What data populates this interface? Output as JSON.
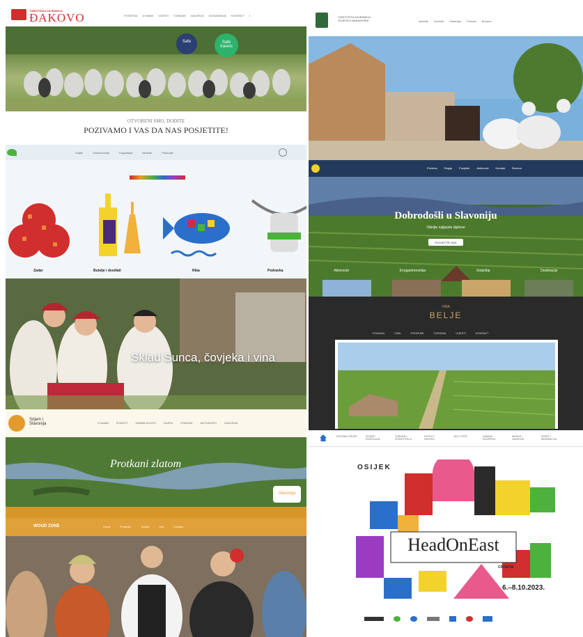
{
  "djakovo": {
    "logo_top": "TURISTIČKA ZAJEDNICA",
    "logo_main": "ĐAKOVO",
    "nav": [
      "POČETNA",
      "O NAMA",
      "VIJESTI",
      "TURIZAM",
      "GALERIJA",
      "DOGAĐANJA",
      "KONTAKT"
    ],
    "badge_safe": "Safe",
    "badge_safe_travels": "Safe travels",
    "subtitle": "OTVORENI SMO, DOĐITE",
    "headline": "POZIVAMO I VAS DA NAS POSJETITE!"
  },
  "lipizzaner": {
    "logo_text": "TURISTIČKA ZAJEDNICA OSJEČKO-BARANJSKE",
    "nav": [
      "Istražite",
      "Doživite",
      "Planirajte",
      "Ponude",
      "Brošure"
    ]
  },
  "gastro": {
    "nav": [
      "Osijek",
      "Gastronomija",
      "Događanja",
      "Istražite",
      "Planirajte"
    ],
    "items": [
      {
        "label": "Zadar"
      },
      {
        "label": "Butelje i destilati"
      },
      {
        "label": "Riba"
      },
      {
        "label": "Podravka"
      }
    ]
  },
  "slavonija_welcome": {
    "nav": [
      "Početna",
      "Regija",
      "Posjetite",
      "Aktivnosti",
      "Kontakt",
      "Brošure"
    ],
    "headline": "Dobrodošli u Slavoniju",
    "sub": "Otkrijte najljepše dijelove",
    "button": "POSJETITE NAS",
    "categories": [
      "Aktivnosti",
      "Enogastronomija",
      "Smještaj",
      "Destinacije"
    ]
  },
  "folk": {
    "headline": "Sklad Sunca, čovjeka i vina"
  },
  "belje": {
    "brand_top": "VINA",
    "brand": "BELJE",
    "nav": [
      "PONUDA",
      "VINA",
      "PODRUMI",
      "TURIZAM",
      "VIJESTI",
      "KONTAKT"
    ]
  },
  "zlatom": {
    "logo_text": "Srijem i Slavonija",
    "nav": [
      "O NAMA",
      "POSJETI",
      "ZANIMLJIVOSTI",
      "KARTA",
      "PONUDA",
      "AKTIVNOSTI",
      "GALERIJA"
    ],
    "headline": "Protkani zlatom",
    "badge": "Slavonija"
  },
  "osijek_nav": {
    "items": [
      "UPOZNAJ OSIJEK",
      "ISTRAŽI DOŽIVLJAJE",
      "TURIZAM I POSJETITELJI",
      "HOTELI I HOSTELI",
      "JELO I PIĆE",
      "ZABAVA I SHOPPING",
      "MUZEJI I GALERIJE",
      "SPORT I REKREACIJA"
    ]
  },
  "festival_wood": {
    "brand": "WOOD ZONE",
    "nav": [
      "Home",
      "Program",
      "Tickets",
      "Info",
      "Contact"
    ]
  },
  "headoneast": {
    "city": "OSIJEK",
    "title": "HeadOnEast",
    "country": "CROATIA",
    "dates": "6.–8.10.2023."
  },
  "colors": {
    "red": "#d12e2e",
    "orange": "#e39b2d",
    "dark": "#2a2a2a",
    "navy": "#233a5c"
  }
}
